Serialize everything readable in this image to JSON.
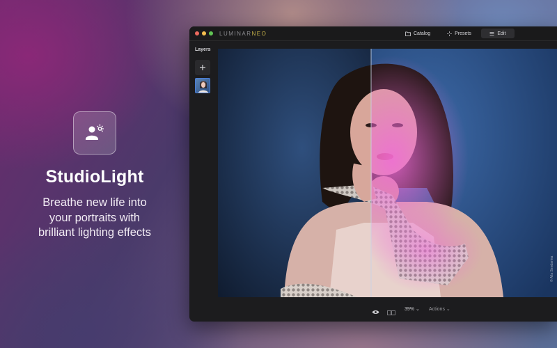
{
  "promo": {
    "icon": "person-light-icon",
    "title": "StudioLight",
    "subtitle_lines": [
      "Breathe new life into",
      "your portraits with",
      "brilliant lighting effects"
    ]
  },
  "app": {
    "brand": "LUMINAR",
    "brand_suffix": "NEO",
    "nav": {
      "catalog": "Catalog",
      "presets": "Presets",
      "edit": "Edit",
      "active": "edit"
    },
    "layers": {
      "title": "Layers",
      "add_icon": "plus-icon"
    },
    "footer": {
      "zoom": "39%",
      "actions": "Actions"
    }
  },
  "photo_credit": "© Alla Sendarina",
  "colors": {
    "accent": "#4a7ed8",
    "traffic_red": "#ed6a5e",
    "traffic_yellow": "#f4be4f",
    "traffic_green": "#61c454"
  }
}
